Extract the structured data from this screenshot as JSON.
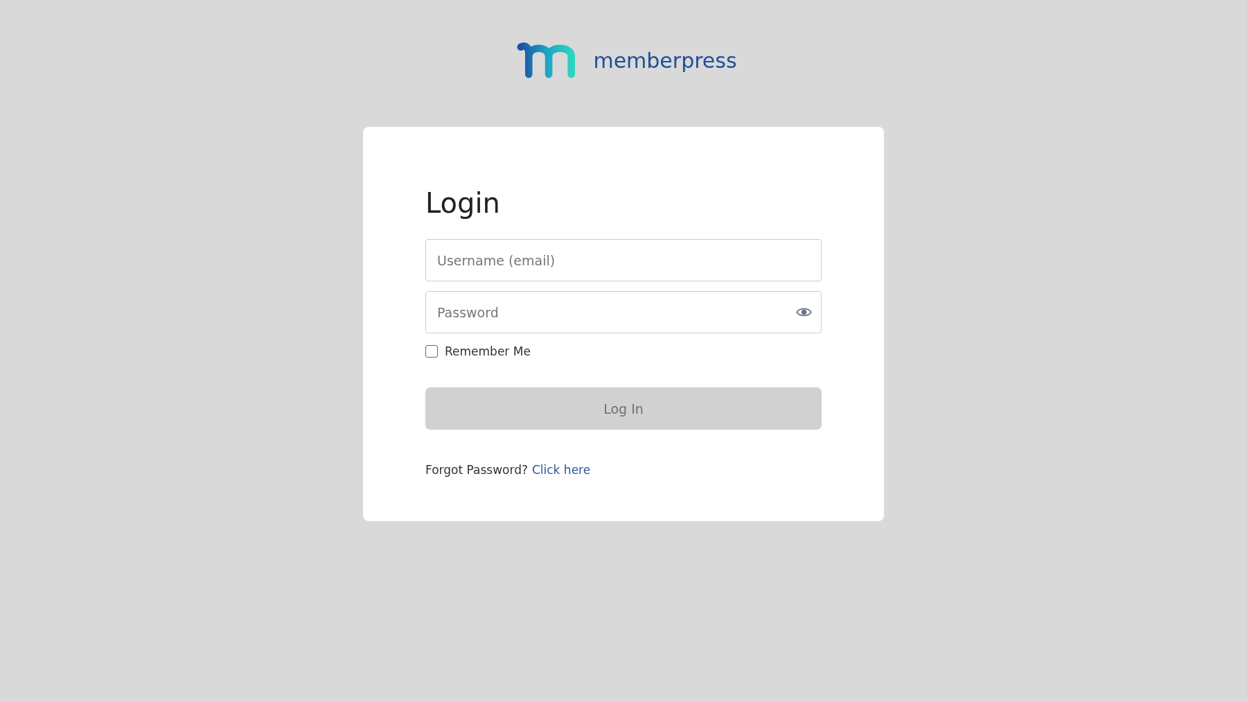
{
  "logo": {
    "text": "memberpress"
  },
  "login_card": {
    "title": "Login",
    "username_field": {
      "placeholder": "Username (email)"
    },
    "password_field": {
      "placeholder": "Password"
    },
    "remember_me": {
      "label": "Remember Me",
      "checked": false
    },
    "login_button": {
      "label": "Log In",
      "disabled": true
    },
    "forgot_password": {
      "text": "Forgot Password?",
      "link": "Click here"
    }
  }
}
